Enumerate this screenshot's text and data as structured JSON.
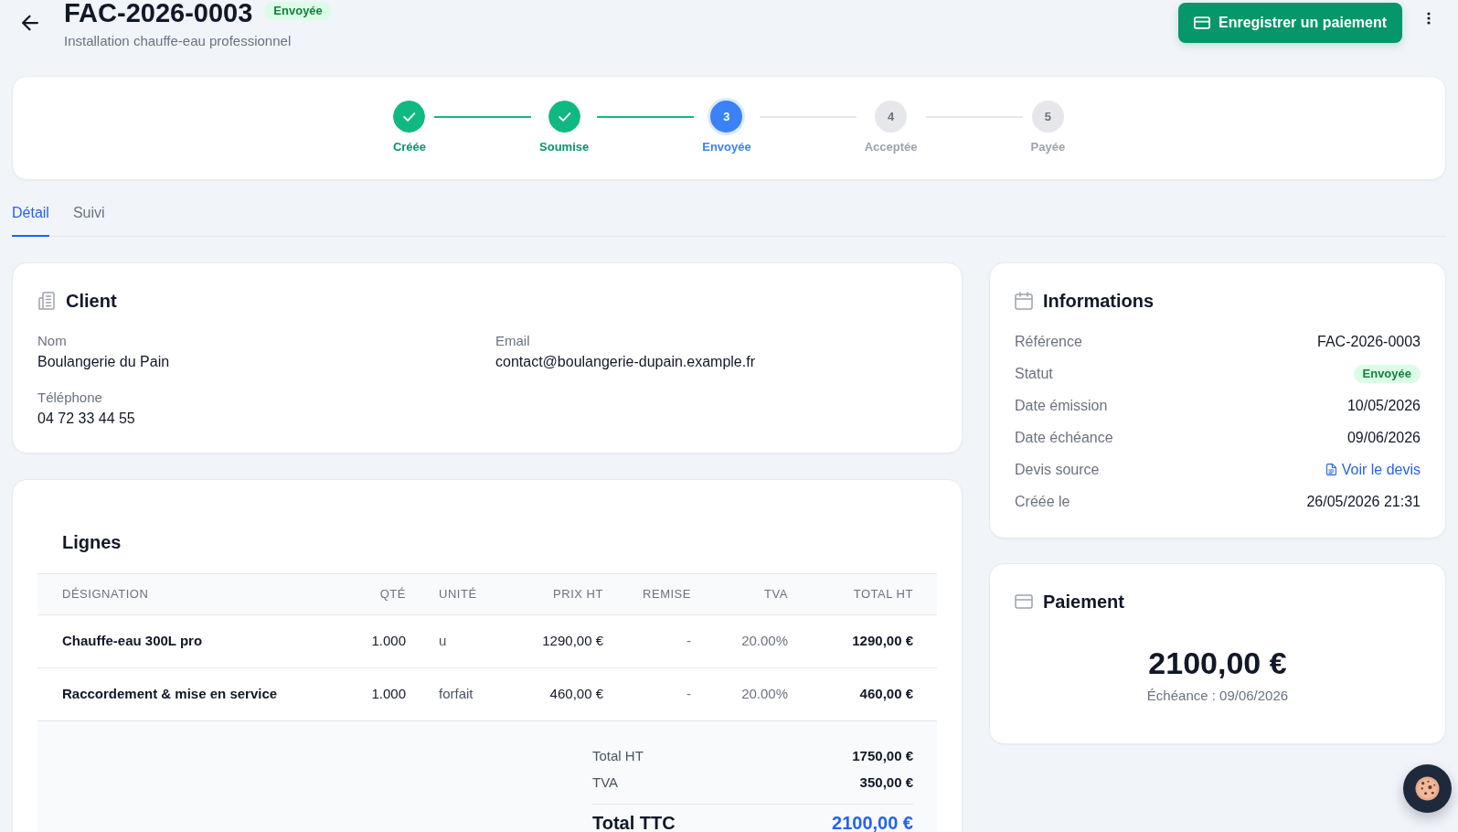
{
  "header": {
    "title": "FAC-2026-0003",
    "status": "Envoyée",
    "subtitle": "Installation chauffe-eau professionnel",
    "primary_action": "Enregistrer un paiement"
  },
  "progress_steps": [
    {
      "label": "Créée",
      "completed": true,
      "current": false
    },
    {
      "label": "Soumise",
      "completed": true,
      "current": false
    },
    {
      "label": "Envoyée",
      "number": "3",
      "completed": false,
      "current": true
    },
    {
      "label": "Acceptée",
      "number": "4",
      "completed": false,
      "current": false
    },
    {
      "label": "Payée",
      "number": "5",
      "completed": false,
      "current": false
    }
  ],
  "tabs": [
    {
      "label": "Détail",
      "selected": true
    },
    {
      "label": "Suivi",
      "selected": false
    }
  ],
  "client": {
    "title": "Client",
    "fields": [
      {
        "label": "Nom",
        "value": "Boulangerie du Pain"
      },
      {
        "label": "Email",
        "value": "contact@boulangerie-dupain.example.fr"
      },
      {
        "label": "Téléphone",
        "value": "04 72 33 44 55"
      }
    ]
  },
  "lines": {
    "title": "Lignes",
    "table": {
      "columns": [
        {
          "label": "DÉSIGNATION",
          "kind": "name"
        },
        {
          "label": "QTÉ",
          "kind": "number"
        },
        {
          "label": "UNITÉ",
          "kind": "unit"
        },
        {
          "label": "PRIX HT",
          "kind": "number"
        },
        {
          "label": "REMISE",
          "kind": "muted"
        },
        {
          "label": "TVA",
          "kind": "muted"
        },
        {
          "label": "TOTAL HT",
          "kind": "total"
        }
      ],
      "rows": [
        [
          "Chauffe-eau 300L pro",
          "1.000",
          "u",
          "1290,00 €",
          "-",
          "20.00%",
          "1290,00 €"
        ],
        [
          "Raccordement & mise en service",
          "1.000",
          "forfait",
          "460,00 €",
          "-",
          "20.00%",
          "460,00 €"
        ]
      ]
    },
    "totals": [
      {
        "label": "Total HT",
        "value": "1750,00 €",
        "kind": "subtotal"
      },
      {
        "label": "TVA",
        "value": "350,00 €",
        "kind": "subtotal"
      },
      {
        "label": "Total TTC",
        "value": "2100,00 €",
        "kind": "grand_total"
      }
    ]
  },
  "informations": {
    "title": "Informations",
    "rows": [
      {
        "label": "Référence",
        "value": "FAC-2026-0003",
        "kind": "text"
      },
      {
        "label": "Statut",
        "value": "Envoyée",
        "kind": "badge"
      },
      {
        "label": "Date émission",
        "value": "10/05/2026",
        "kind": "text"
      },
      {
        "label": "Date échéance",
        "value": "09/06/2026",
        "kind": "text"
      },
      {
        "label": "Devis source",
        "value": "Voir le devis",
        "kind": "link"
      },
      {
        "label": "Créée le",
        "value": "26/05/2026 21:31",
        "kind": "text"
      }
    ]
  },
  "payment": {
    "title": "Paiement",
    "amount": "2100,00 €",
    "due": "Échéance : 09/06/2026"
  }
}
